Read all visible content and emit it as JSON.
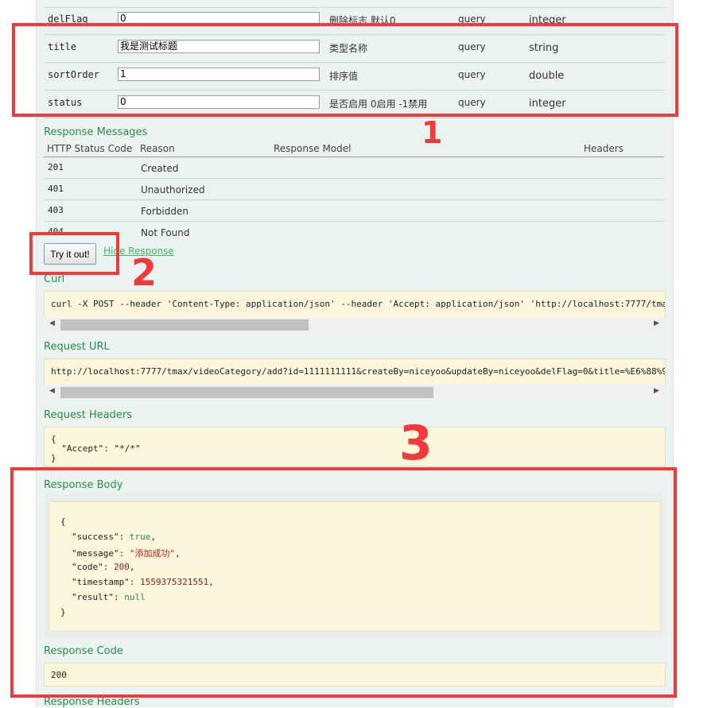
{
  "params": [
    {
      "name": "delFlag",
      "value": "0",
      "description": "删除标志 默认0",
      "param_type": "query",
      "data_type": "integer"
    },
    {
      "name": "title",
      "value": "我是测试标题",
      "description": "类型名称",
      "param_type": "query",
      "data_type": "string"
    },
    {
      "name": "sortOrder",
      "value": "1",
      "description": "排序值",
      "param_type": "query",
      "data_type": "double"
    },
    {
      "name": "status",
      "value": "0",
      "description": "是否启用 0启用 -1禁用",
      "param_type": "query",
      "data_type": "integer"
    }
  ],
  "response_messages": {
    "heading": "Response Messages",
    "columns": {
      "status": "HTTP Status Code",
      "reason": "Reason",
      "model": "Response Model",
      "headers": "Headers"
    },
    "rows": [
      {
        "code": "201",
        "reason": "Created"
      },
      {
        "code": "401",
        "reason": "Unauthorized"
      },
      {
        "code": "403",
        "reason": "Forbidden"
      },
      {
        "code": "404",
        "reason": "Not Found"
      }
    ]
  },
  "try_button": "Try it out!",
  "hide_link": "Hide Response",
  "curl": {
    "heading": "Curl",
    "text": "curl -X POST --header 'Content-Type: application/json' --header 'Accept: application/json' 'http://localhost:7777/tma"
  },
  "request_url": {
    "heading": "Request URL",
    "text": "http://localhost:7777/tmax/videoCategory/add?id=1111111111&createBy=niceyoo&updateBy=niceyoo&delFlag=0&title=%E6%88%9"
  },
  "request_headers": {
    "heading": "Request Headers",
    "lines": [
      "{",
      "  \"Accept\": \"*/*\"",
      "}"
    ]
  },
  "response_body": {
    "heading": "Response Body",
    "open": "{",
    "close": "}",
    "entries": [
      {
        "key": "\"success\"",
        "value": "true",
        "comma": ","
      },
      {
        "key": "\"message\"",
        "value": "\"添加成功\"",
        "comma": ","
      },
      {
        "key": "\"code\"",
        "value": "200",
        "comma": ","
      },
      {
        "key": "\"timestamp\"",
        "value": "1559375321551",
        "comma": ","
      },
      {
        "key": "\"result\"",
        "value": "null",
        "comma": ""
      }
    ]
  },
  "response_code": {
    "heading": "Response Code",
    "value": "200"
  },
  "response_headers": {
    "heading": "Response Headers"
  },
  "annotations": {
    "one": "1",
    "two": "2",
    "three": "3",
    "color": "#f2393c"
  },
  "colors": {
    "accent": "#2a8a4c",
    "codebox_bg": "#fcf6db",
    "panel_bg": "#ebf3f1"
  }
}
